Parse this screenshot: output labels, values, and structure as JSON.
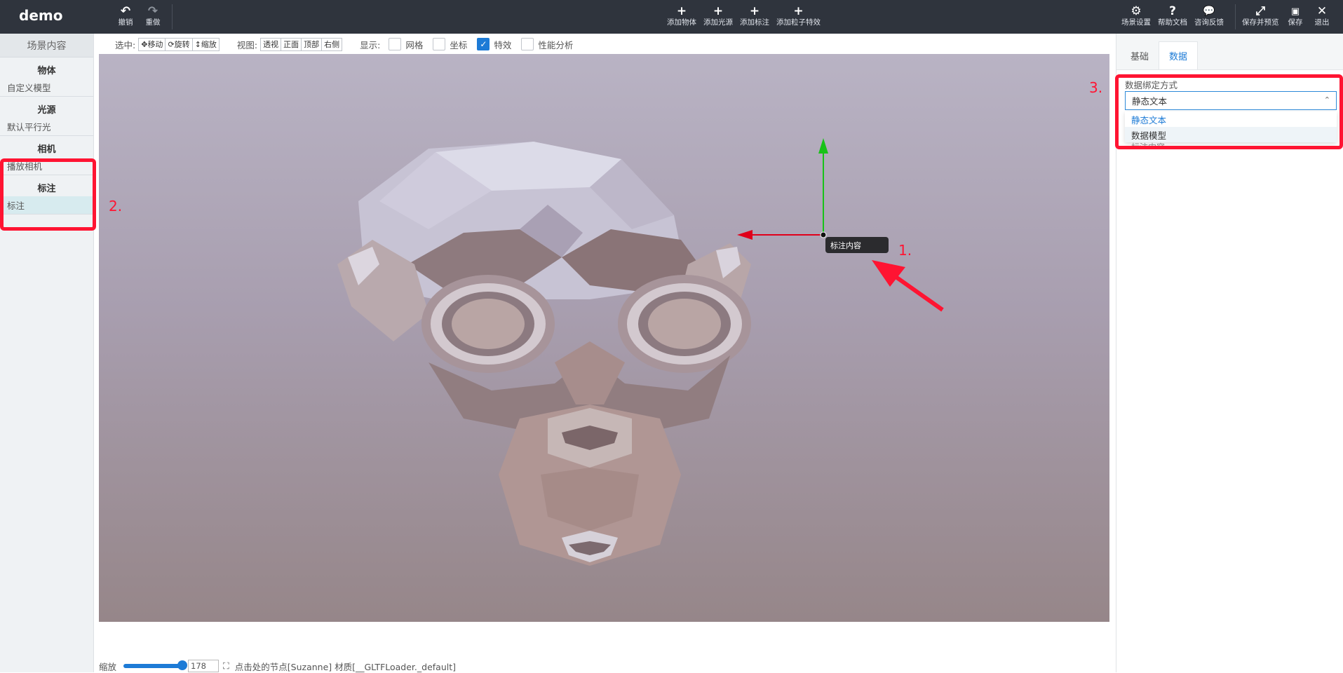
{
  "app": {
    "title": "demo"
  },
  "topbar": {
    "undo": "撤销",
    "redo": "重做",
    "add_object": "添加物体",
    "add_light": "添加光源",
    "add_label": "添加标注",
    "add_particle": "添加粒子特效",
    "scene_settings": "场景设置",
    "help_docs": "帮助文档",
    "feedback": "咨询反馈",
    "save_preview": "保存并预览",
    "save": "保存",
    "exit": "退出"
  },
  "left_panel": {
    "header": "场景内容",
    "sections": [
      {
        "title": "物体",
        "items": [
          "自定义模型"
        ]
      },
      {
        "title": "光源",
        "items": [
          "默认平行光"
        ]
      },
      {
        "title": "相机",
        "items": [
          "播放相机"
        ]
      },
      {
        "title": "标注",
        "items": [
          "标注"
        ]
      }
    ]
  },
  "viewport_toolbar": {
    "select_label": "选中:",
    "move": "移动",
    "rotate": "旋转",
    "scale": "缩放",
    "view_label": "视图:",
    "views": [
      "透视",
      "正面",
      "顶部",
      "右侧"
    ],
    "display_label": "显示:",
    "grid": {
      "label": "网格",
      "checked": false
    },
    "axes": {
      "label": "坐标",
      "checked": false
    },
    "effects": {
      "label": "特效",
      "checked": true
    },
    "perf": {
      "label": "性能分析",
      "checked": false
    }
  },
  "viewport": {
    "label_tooltip": "标注内容",
    "axis_colors": {
      "x": "#e0001b",
      "y": "#18c218"
    }
  },
  "bottombar": {
    "zoom_label": "缩放",
    "zoom_value": "178",
    "zoom_fraction": 0.72,
    "status": "点击处的节点[Suzanne] 材质[__GLTFLoader._default]"
  },
  "right_panel": {
    "tabs": [
      "基础",
      "数据"
    ],
    "active_tab": "数据",
    "bind_label": "数据绑定方式",
    "bind_value": "静态文本",
    "options": [
      "静态文本",
      "数据模型"
    ],
    "hidden_field": "标注内容"
  },
  "annotations": [
    "1.",
    "2.",
    "3."
  ],
  "colors": {
    "topbar": "#2f343d",
    "accent": "#1d7bd6",
    "annotation": "#ff1432"
  }
}
